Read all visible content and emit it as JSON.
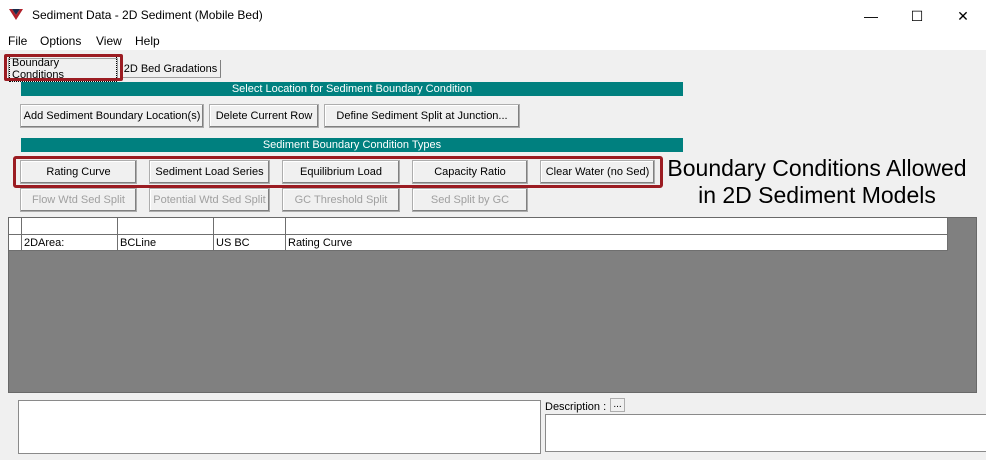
{
  "window": {
    "title": "Sediment Data - 2D Sediment (Mobile Bed)",
    "minimize": "—",
    "maximize": "☐",
    "close": "✕",
    "icon": "hec-ras-app-icon"
  },
  "menu": {
    "items": [
      {
        "label": "File"
      },
      {
        "label": "Options"
      },
      {
        "label": "View"
      },
      {
        "label": "Help"
      }
    ]
  },
  "tabs": [
    {
      "label": "Boundary Conditions",
      "active": true
    },
    {
      "label": "2D Bed Gradations",
      "active": false
    }
  ],
  "location_section": {
    "header": "Select Location for Sediment Boundary Condition",
    "buttons": [
      {
        "label": "Add Sediment Boundary Location(s)"
      },
      {
        "label": "Delete Current Row"
      },
      {
        "label": "Define Sediment Split at Junction..."
      }
    ]
  },
  "types_section": {
    "header": "Sediment Boundary Condition Types",
    "buttons": [
      {
        "label": "Rating Curve"
      },
      {
        "label": "Sediment Load Series"
      },
      {
        "label": "Equilibrium Load"
      },
      {
        "label": "Capacity Ratio"
      },
      {
        "label": "Clear Water (no Sed)"
      }
    ],
    "disabled_buttons": [
      {
        "label": "Flow Wtd Sed Split"
      },
      {
        "label": "Potential Wtd Sed Split"
      },
      {
        "label": "GC Threshold Split"
      },
      {
        "label": "Sed Split by GC"
      }
    ]
  },
  "annotation": {
    "line1": "Boundary Conditions Allowed",
    "line2": "in 2D Sediment Models",
    "highlight_color": "#9b1c22"
  },
  "grid": {
    "headers": [
      "",
      "",
      "",
      "",
      ""
    ],
    "rows": [
      [
        "",
        "2DArea:",
        "BCLine",
        "US BC",
        "Rating Curve"
      ]
    ]
  },
  "description": {
    "label": "Description :",
    "button": "..."
  },
  "colors": {
    "section_header_bg": "#00807f",
    "grid_bg": "#808080"
  }
}
